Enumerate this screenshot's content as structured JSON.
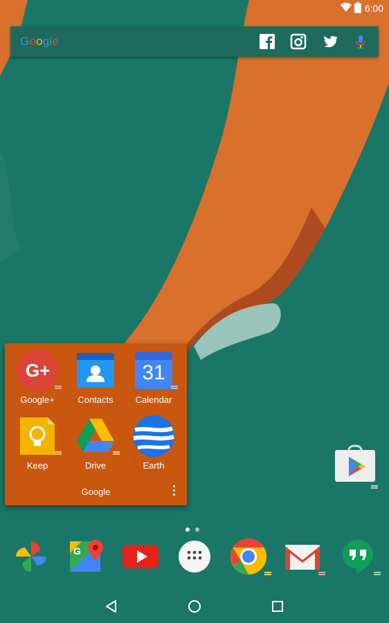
{
  "status_bar": {
    "time": "6:00"
  },
  "search_bar": {
    "logo_letters": [
      "G",
      "o",
      "o",
      "g",
      "l",
      "e"
    ],
    "icons": [
      "facebook-icon",
      "instagram-icon",
      "twitter-icon",
      "microphone-icon"
    ]
  },
  "folder": {
    "name": "Google",
    "apps": [
      {
        "label": "Google+"
      },
      {
        "label": "Contacts"
      },
      {
        "label": "Calendar"
      },
      {
        "label": "Keep"
      },
      {
        "label": "Drive"
      },
      {
        "label": "Earth"
      }
    ],
    "calendar_day": "31"
  },
  "colors": {
    "folder_bg": "#c9570f",
    "search_bg": "#1e6a5c",
    "sea": "#1f7a6a",
    "sand": "#d9702c"
  },
  "dock": {
    "apps": [
      "photos-icon",
      "maps-icon",
      "youtube-icon",
      "app-drawer-icon",
      "chrome-icon",
      "gmail-icon",
      "hangouts-icon"
    ]
  },
  "home": {
    "page_count": 2,
    "current_page": 1,
    "extra_icons": [
      "play-store-icon"
    ]
  },
  "nav": {
    "buttons": [
      "back-icon",
      "home-icon",
      "recents-icon"
    ]
  }
}
